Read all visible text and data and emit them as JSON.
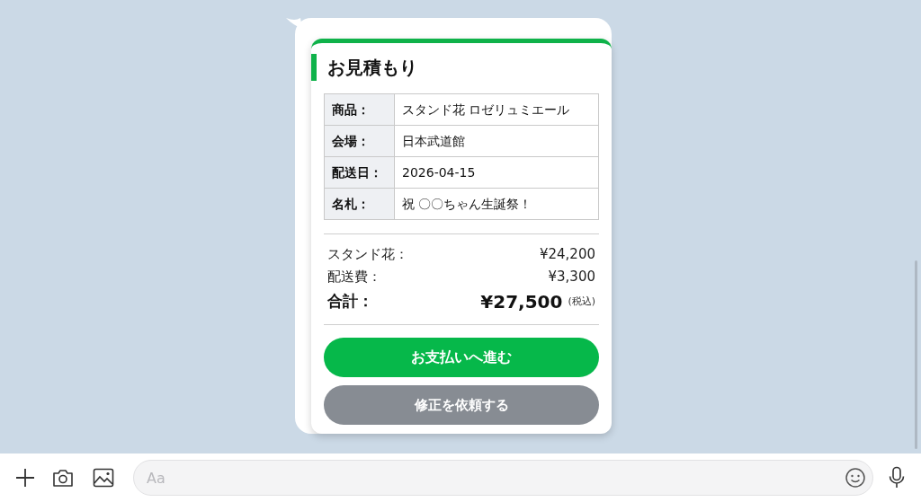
{
  "quote": {
    "title": "お見積もり",
    "details": [
      {
        "label": "商品：",
        "value": "スタンド花 ロゼリュミエール"
      },
      {
        "label": "会場：",
        "value": "日本武道館"
      },
      {
        "label": "配送日：",
        "value": "2026-04-15"
      },
      {
        "label": "名札：",
        "value": "祝 〇〇ちゃん生誕祭！"
      }
    ],
    "summary": [
      {
        "kind": "line",
        "label": "スタンド花：",
        "amount": "¥24,200"
      },
      {
        "kind": "line",
        "label": "配送費：",
        "amount": "¥3,300"
      },
      {
        "kind": "total",
        "label": "合計：",
        "amount": "¥27,500",
        "note": "(税込)"
      }
    ],
    "buttons": [
      {
        "kind": "primary",
        "label": "お支払いへ進む"
      },
      {
        "kind": "secondary",
        "label": "修正を依頼する"
      }
    ]
  },
  "composer": {
    "placeholder": "Aa"
  }
}
